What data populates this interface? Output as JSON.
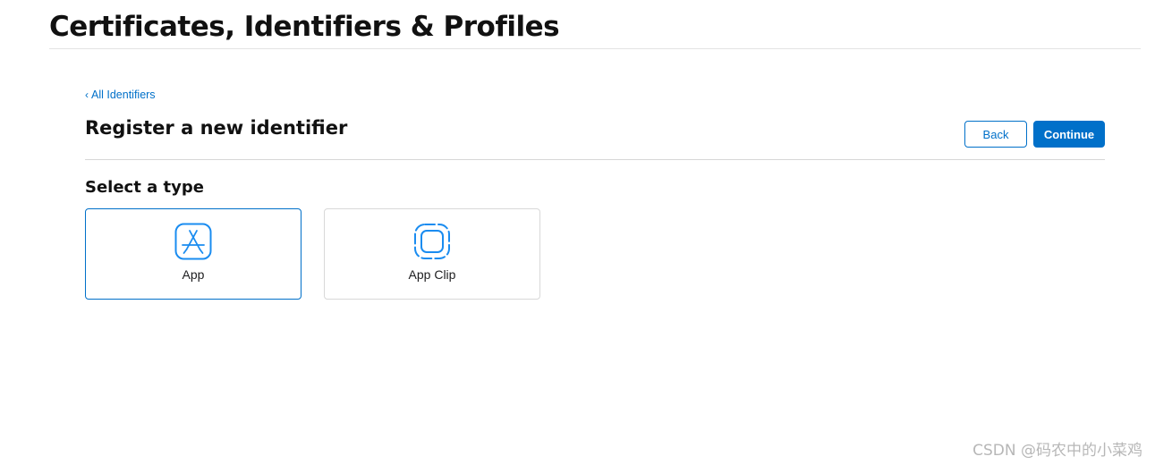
{
  "header": {
    "title": "Certificates, Identifiers & Profiles"
  },
  "breadcrumb": {
    "chevron": "‹",
    "label": "All Identifiers"
  },
  "section": {
    "title": "Register a new identifier"
  },
  "actions": {
    "back_label": "Back",
    "continue_label": "Continue"
  },
  "type_selector": {
    "heading": "Select a type",
    "options": [
      {
        "label": "App",
        "icon": "app-store-icon",
        "selected": true
      },
      {
        "label": "App Clip",
        "icon": "app-clip-icon",
        "selected": false
      }
    ]
  },
  "watermark": {
    "text": "CSDN @码农中的小菜鸡"
  },
  "colors": {
    "accent": "#0070c9",
    "text": "#111111",
    "divider": "#d6d6d6",
    "card_border": "#d8d8d8",
    "icon_blue": "#1a8cf0"
  }
}
